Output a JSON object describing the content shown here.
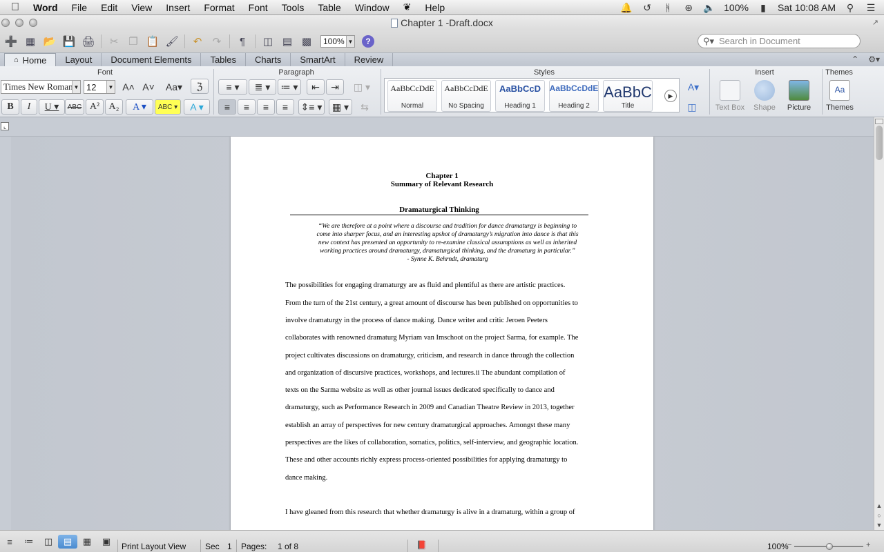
{
  "menubar": {
    "app": "Word",
    "items": [
      "File",
      "Edit",
      "View",
      "Insert",
      "Format",
      "Font",
      "Tools",
      "Table",
      "Window",
      "Help"
    ],
    "battery": "100%",
    "clock": "Sat 10:08 AM"
  },
  "window": {
    "title": "Chapter 1 -Draft.docx"
  },
  "toolbar": {
    "zoom": "100%",
    "search_placeholder": "Search in Document"
  },
  "tabs": [
    "Home",
    "Layout",
    "Document Elements",
    "Tables",
    "Charts",
    "SmartArt",
    "Review"
  ],
  "ribbon": {
    "groups": {
      "font": "Font",
      "paragraph": "Paragraph",
      "styles": "Styles",
      "insert": "Insert",
      "themes": "Themes"
    },
    "font_name": "Times New Roman",
    "font_size": "12",
    "styles": [
      {
        "sample": "AaBbCcDdE",
        "name": "Normal"
      },
      {
        "sample": "AaBbCcDdE",
        "name": "No Spacing"
      },
      {
        "sample": "AaBbCcD",
        "name": "Heading 1"
      },
      {
        "sample": "AaBbCcDdE",
        "name": "Heading 2"
      },
      {
        "sample": "AaBbC",
        "name": "Title"
      }
    ],
    "insert_items": [
      "Text Box",
      "Shape",
      "Picture"
    ],
    "themes_label": "Themes"
  },
  "document": {
    "chapter": "Chapter 1",
    "subtitle": "Summary of Relevant Research",
    "section_heading": "Dramaturgical Thinking",
    "epigraph": [
      "“We are therefore at a point where a discourse and tradition for dance dramaturgy is beginning to",
      "come into sharper focus, and an interesting upshot of dramaturgy’s migration into dance is that this",
      "new context has presented an opportunity to re-examine classical assumptions as well as inherited",
      "working practices around dramaturgy, dramaturgical thinking, and the dramaturg in particular.”",
      "- Synne K. Behrndt, dramaturg"
    ],
    "body_lines": [
      "The possibilities for engaging dramaturgy are as fluid and plentiful as there are artistic practices.",
      "From the turn of the 21st century, a great amount of discourse has been published on opportunities to",
      "involve dramaturgy in the process of dance making. Dance writer and critic Jeroen Peeters",
      "collaborates with renowned dramaturg Myriam van Imschoot on the project Sarma, for example. The",
      "project cultivates discussions on dramaturgy, criticism, and research in dance through the collection",
      "and organization of discursive practices, workshops, and lectures.ii The abundant compilation of",
      "texts on the Sarma website as well as other journal issues dedicated specifically to dance and",
      "dramaturgy, such as Performance Research in 2009 and Canadian Theatre Review in 2013, together",
      "establish an array of perspectives for new century dramaturgical approaches. Amongst these many",
      "perspectives are the likes of collaboration, somatics, politics, self-interview, and geographic location.",
      "These and other accounts richly express process-oriented possibilities for applying dramaturgy to",
      "dance making.",
      "I have gleaned from this research that whether dramaturgy is alive in a dramaturg, within a group of"
    ]
  },
  "statusbar": {
    "view": "Print Layout View",
    "sec_label": "Sec",
    "sec_value": "1",
    "pages_label": "Pages:",
    "pages_value": "1 of 8",
    "zoom": "100%"
  }
}
